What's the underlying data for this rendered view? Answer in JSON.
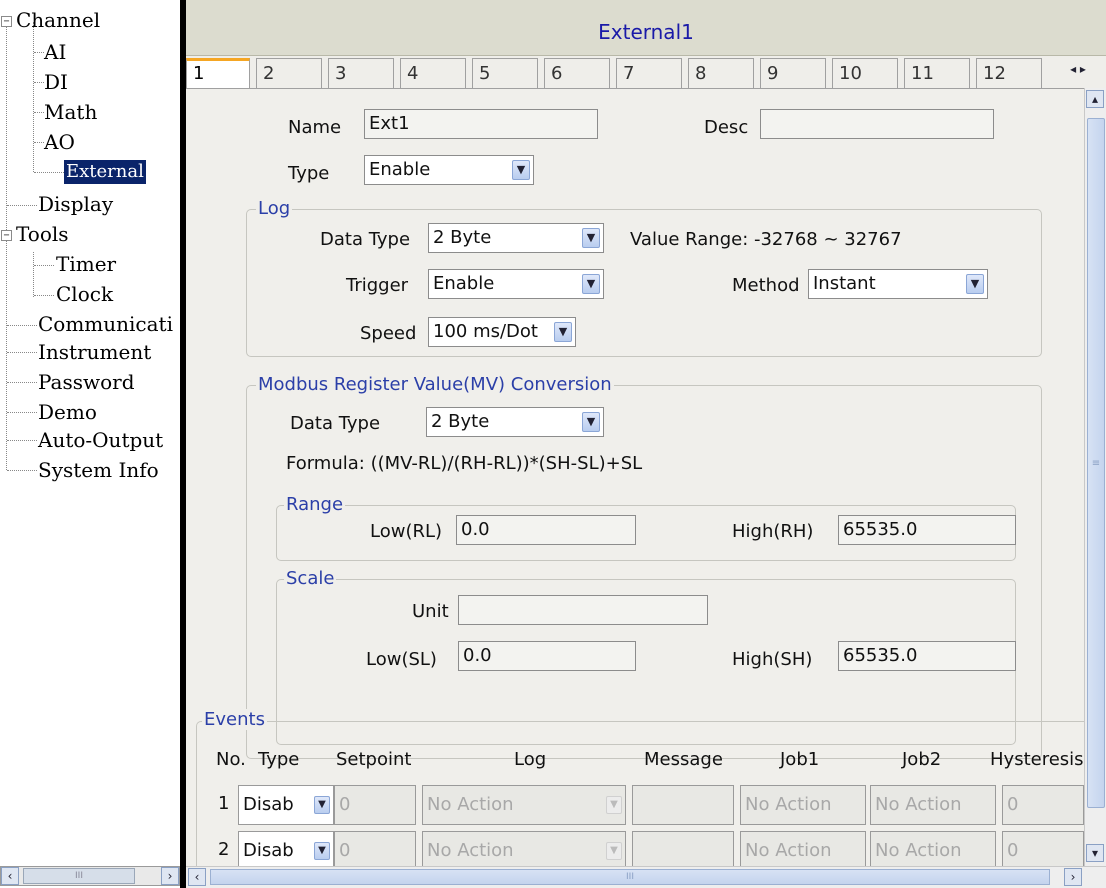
{
  "tree": {
    "items": [
      {
        "label": "Channel"
      },
      {
        "label": "AI"
      },
      {
        "label": "DI"
      },
      {
        "label": "Math"
      },
      {
        "label": "AO"
      },
      {
        "label": "External"
      },
      {
        "label": "Display"
      },
      {
        "label": "Tools"
      },
      {
        "label": "Timer"
      },
      {
        "label": "Clock"
      },
      {
        "label": "Communicati"
      },
      {
        "label": "Instrument"
      },
      {
        "label": "Password"
      },
      {
        "label": "Demo"
      },
      {
        "label": "Auto-Output"
      },
      {
        "label": "System Info"
      }
    ],
    "selected": "External",
    "scroll_thumb_label": "III"
  },
  "panel": {
    "title": "External1",
    "tabs": [
      "1",
      "2",
      "3",
      "4",
      "5",
      "6",
      "7",
      "8",
      "9",
      "10",
      "11",
      "12"
    ],
    "active_tab": "1"
  },
  "form": {
    "name_label": "Name",
    "name_value": "Ext1",
    "desc_label": "Desc",
    "desc_value": "",
    "type_label": "Type",
    "type_value": "Enable"
  },
  "log": {
    "title": "Log",
    "data_type_label": "Data Type",
    "data_type_value": "2 Byte",
    "value_range": "Value Range: -32768 ~ 32767",
    "trigger_label": "Trigger",
    "trigger_value": "Enable",
    "method_label": "Method",
    "method_value": "Instant",
    "speed_label": "Speed",
    "speed_value": "100 ms/Dot"
  },
  "modbus": {
    "title": "Modbus Register Value(MV) Conversion",
    "data_type_label": "Data Type",
    "data_type_value": "2 Byte",
    "formula": "Formula: ((MV-RL)/(RH-RL))*(SH-SL)+SL",
    "range": {
      "title": "Range",
      "low_label": "Low(RL)",
      "low_value": "0.0",
      "high_label": "High(RH)",
      "high_value": "65535.0"
    },
    "scale": {
      "title": "Scale",
      "unit_label": "Unit",
      "unit_value": "",
      "low_label": "Low(SL)",
      "low_value": "0.0",
      "high_label": "High(SH)",
      "high_value": "65535.0"
    }
  },
  "events": {
    "title": "Events",
    "columns": [
      "No.",
      "Type",
      "Setpoint",
      "Log",
      "Message",
      "Job1",
      "Job2",
      "Hysteresis"
    ],
    "rows": [
      {
        "no": "1",
        "type": "Disab",
        "setpoint": "0",
        "log": "No Action",
        "message": "",
        "job1": "No Action",
        "job2": "No Action",
        "hysteresis": "0"
      },
      {
        "no": "2",
        "type": "Disab",
        "setpoint": "0",
        "log": "No Action",
        "message": "",
        "job1": "No Action",
        "job2": "No Action",
        "hysteresis": "0"
      }
    ]
  },
  "scrollbars": {
    "bottom_thumb_label": "III",
    "right_thumb_label": "≡"
  },
  "colors": {
    "title_text": "#1a1aa8",
    "group_title": "#2b3fa8",
    "selection": "#0a246a",
    "active_tab_accent": "#f5a623"
  }
}
